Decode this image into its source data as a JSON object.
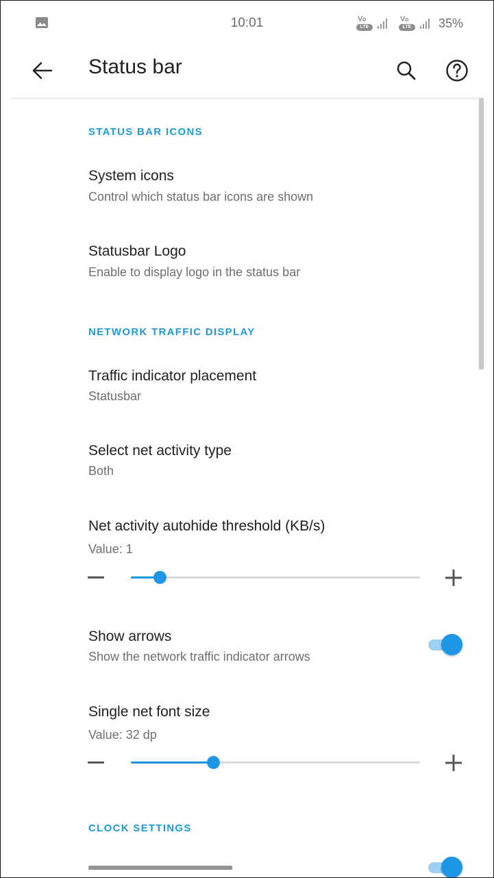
{
  "status_bar": {
    "time": "10:01",
    "battery": "35%",
    "sim1_label": "VoLTE",
    "sim2_label": "VoLTE",
    "icons": [
      "image-icon",
      "volte-icon",
      "signal-icon",
      "volte-icon",
      "signal-icon"
    ]
  },
  "app_bar": {
    "title": "Status bar",
    "icons": [
      "back-arrow-icon",
      "search-icon",
      "help-icon"
    ]
  },
  "sections": {
    "status_bar_icons": {
      "header": "STATUS BAR ICONS",
      "system_icons": {
        "title": "System icons",
        "summary": "Control which status bar icons are shown"
      },
      "statusbar_logo": {
        "title": "Statusbar Logo",
        "summary": "Enable to display logo in the status bar"
      }
    },
    "network_traffic": {
      "header": "NETWORK TRAFFIC DISPLAY",
      "placement": {
        "title": "Traffic indicator placement",
        "summary": "Statusbar"
      },
      "activity_type": {
        "title": "Select net activity type",
        "summary": "Both"
      },
      "autohide": {
        "title": "Net activity autohide threshold (KB/s)",
        "summary": "Value: 1",
        "slider_fraction": 0.1
      },
      "show_arrows": {
        "title": "Show arrows",
        "summary": "Show the network traffic indicator arrows",
        "enabled": true
      },
      "font_size": {
        "title": "Single net font size",
        "summary": "Value: 32 dp",
        "slider_fraction": 0.285
      }
    },
    "clock": {
      "header": "CLOCK SETTINGS",
      "partial_row_enabled": true
    }
  },
  "colors": {
    "accent": "#1e96e6",
    "section_header": "#1e9bd7",
    "switch_track": "#9fd0f2"
  }
}
